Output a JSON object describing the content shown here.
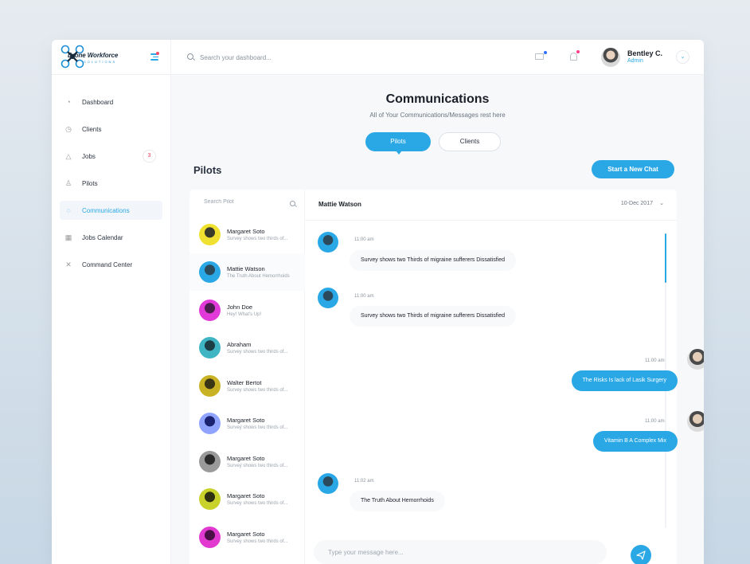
{
  "brand": {
    "name": "Drone Workforce",
    "tagline": "SOLUTIONS",
    "registered": "®"
  },
  "search": {
    "placeholder": "Search your dashboard..."
  },
  "user": {
    "name": "Bentley C.",
    "role": "Admin"
  },
  "sidebar": {
    "items": [
      {
        "label": "Dashboard",
        "icon": "gauge-icon"
      },
      {
        "label": "Clients",
        "icon": "clock-icon"
      },
      {
        "label": "Jobs",
        "icon": "cone-icon",
        "badge": "3"
      },
      {
        "label": "Pilots",
        "icon": "user-icon"
      },
      {
        "label": "Communications",
        "icon": "chat-icon",
        "active": true
      },
      {
        "label": "Jobs Calendar",
        "icon": "calendar-icon"
      },
      {
        "label": "Command Center",
        "icon": "cross-tools-icon"
      }
    ]
  },
  "page": {
    "title": "Communications",
    "subtitle": "All of Your Communications/Messages rest here",
    "tabs": [
      {
        "label": "Pilots",
        "active": true
      },
      {
        "label": "Clients",
        "active": false
      }
    ],
    "section_title": "Pilots",
    "new_chat_label": "Start a New Chat"
  },
  "contacts": {
    "search_placeholder": "Search Pilot",
    "items": [
      {
        "name": "Margaret Soto",
        "preview": "Survey shows two thirds of..."
      },
      {
        "name": "Mattie Watson",
        "preview": "The Truth About Hemorrhoids",
        "active": true
      },
      {
        "name": "John Doe",
        "preview": "Hey! What's Up!"
      },
      {
        "name": "Abraham",
        "preview": "Survey shows two thirds of..."
      },
      {
        "name": "Walter Bertot",
        "preview": "Survey shows two thirds of..."
      },
      {
        "name": "Margaret Soto",
        "preview": "Survey shows two thirds of..."
      },
      {
        "name": "Margaret Soto",
        "preview": "Survey shows two thirds of..."
      },
      {
        "name": "Margaret Soto",
        "preview": "Survey shows two thirds of..."
      },
      {
        "name": "Margaret Soto",
        "preview": "Survey shows two thirds of..."
      }
    ]
  },
  "chat": {
    "name": "Mattie Watson",
    "date": "10-Dec 2017",
    "messages": [
      {
        "dir": "in",
        "time": "11:00 am",
        "text": "Survey shows two Thirds of migraine sufferers Dissatisfied"
      },
      {
        "dir": "in",
        "time": "11:00 am",
        "text": "Survey shows two Thirds of migraine sufferers Dissatisfied"
      },
      {
        "dir": "out",
        "time": "11:00 am",
        "text": "The Risks Is lack of Lasik Surgery"
      },
      {
        "dir": "out",
        "time": "11:00 am",
        "text": "Vitamin B A Complex Mix"
      },
      {
        "dir": "in",
        "time": "11:02 am",
        "text": "The Truth About Hemorrhoids"
      }
    ],
    "composer_placeholder": "Type your message here..."
  },
  "colors": {
    "accent": "#2aa8e6",
    "badge": "#e23b5c"
  }
}
